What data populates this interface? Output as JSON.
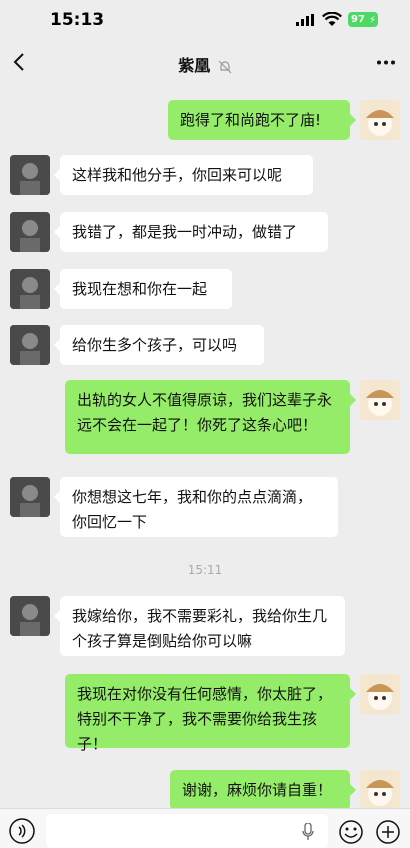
{
  "status": {
    "time": "15:13",
    "battery": "97"
  },
  "nav": {
    "title": "紫凰"
  },
  "messages": [
    {
      "from": "me",
      "text": "跑得了和尚跑不了庙!"
    },
    {
      "from": "them",
      "text": "这样我和他分手，你回来可以呢"
    },
    {
      "from": "them",
      "text": "我错了，都是我一时冲动，做错了"
    },
    {
      "from": "them",
      "text": "我现在想和你在一起"
    },
    {
      "from": "them",
      "text": "给你生多个孩子，可以吗"
    },
    {
      "from": "me",
      "text": "出轨的女人不值得原谅，我们这辈子永远不会在一起了！你死了这条心吧！"
    },
    {
      "from": "them",
      "text": "你想想这七年，我和你的点点滴滴，你回忆一下"
    },
    {
      "from": "them",
      "text": "我嫁给你，我不需要彩礼，我给你生几个孩子算是倒贴给你可以嘛"
    },
    {
      "from": "me",
      "text": "我现在对你没有任何感情，你太脏了，特别不干净了，我不需要你给我生孩子！"
    },
    {
      "from": "me",
      "text": "谢谢，麻烦你请自重！"
    }
  ],
  "timestamp": "15:11",
  "colors": {
    "my_bubble": "#95ec69",
    "their_bubble": "#ffffff",
    "background": "#ededed"
  }
}
